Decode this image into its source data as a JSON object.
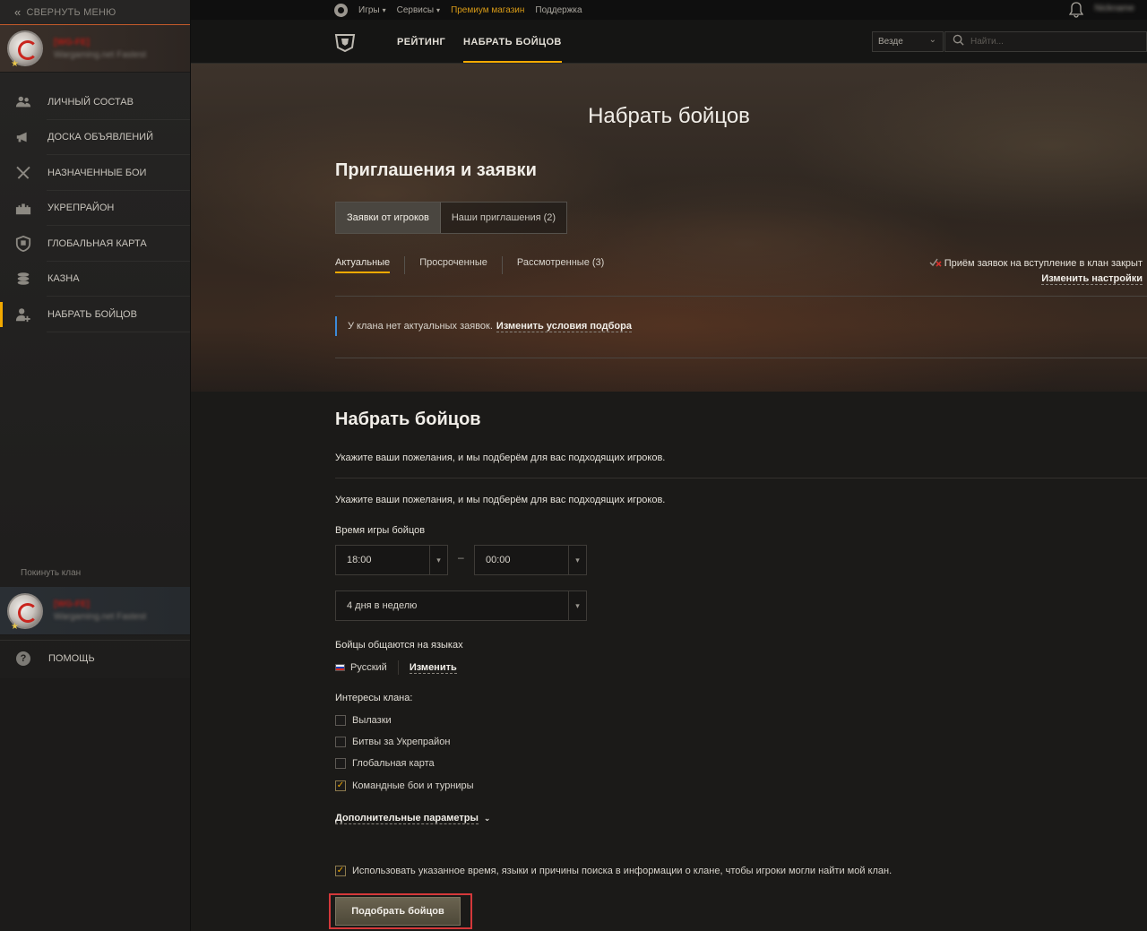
{
  "sidebar": {
    "collapse_label": "СВЕРНУТЬ МЕНЮ",
    "clan_tag": "[WG-FE]",
    "clan_name": "Wargaming.net Fastest",
    "items": [
      {
        "label": "ЛИЧНЫЙ СОСТАВ",
        "icon": "people-icon"
      },
      {
        "label": "ДОСКА ОБЪЯВЛЕНИЙ",
        "icon": "megaphone-icon"
      },
      {
        "label": "НАЗНАЧЕННЫЕ БОИ",
        "icon": "crossed-swords-icon"
      },
      {
        "label": "УКРЕПРАЙОН",
        "icon": "fortress-icon"
      },
      {
        "label": "ГЛОБАЛЬНАЯ КАРТА",
        "icon": "shield-map-icon"
      },
      {
        "label": "КАЗНА",
        "icon": "coins-icon"
      },
      {
        "label": "НАБРАТЬ БОЙЦОВ",
        "icon": "recruit-icon",
        "active": true
      }
    ],
    "leave_clan": "Покинуть клан",
    "help": "ПОМОЩЬ"
  },
  "topbar": {
    "games": "Игры",
    "services": "Сервисы",
    "premium_shop": "Премиум магазин",
    "support": "Поддержка",
    "username": "Nickname"
  },
  "subnav": {
    "rating": "РЕЙТИНГ",
    "recruit": "НАБРАТЬ БОЙЦОВ",
    "region": "Везде",
    "search_placeholder": "Найти..."
  },
  "hero": {
    "page_title": "Набрать бойцов",
    "section_title": "Приглашения и заявки",
    "seg_players": "Заявки от игроков",
    "seg_invites": "Наши приглашения (2)",
    "tab_current": "Актуальные",
    "tab_expired": "Просроченные",
    "tab_reviewed": "Рассмотренные (3)",
    "closed_note": "Приём заявок на вступление в клан закрыт",
    "change_settings": "Изменить настройки",
    "no_requests": "У клана нет актуальных заявок.",
    "change_conditions": "Изменить условия подбора"
  },
  "form": {
    "title": "Набрать бойцов",
    "desc1": "Укажите ваши пожелания, и мы подберём для вас подходящих игроков.",
    "desc2": "Укажите ваши пожелания, и мы подберём для вас подходящих игроков.",
    "time_label": "Время игры бойцов",
    "time_from": "18:00",
    "time_to": "00:00",
    "days": "4 дня в неделю",
    "lang_label": "Бойцы общаются на языках",
    "lang_value": "Русский",
    "lang_change": "Изменить",
    "interests_label": "Интересы клана:",
    "interests": [
      {
        "label": "Вылазки",
        "checked": false
      },
      {
        "label": "Битвы за Укрепрайон",
        "checked": false
      },
      {
        "label": "Глобальная карта",
        "checked": false
      },
      {
        "label": "Командные бои и турниры",
        "checked": true
      }
    ],
    "advanced": "Дополнительные параметры",
    "use_info": "Использовать указанное время, языки и причины поиска в информации о клане, чтобы игроки могли найти мой клан.",
    "submit": "Подобрать бойцов"
  },
  "colors": {
    "accent": "#f2a900",
    "info_bar": "#3c8ad8",
    "highlight_frame": "#d4383a"
  }
}
